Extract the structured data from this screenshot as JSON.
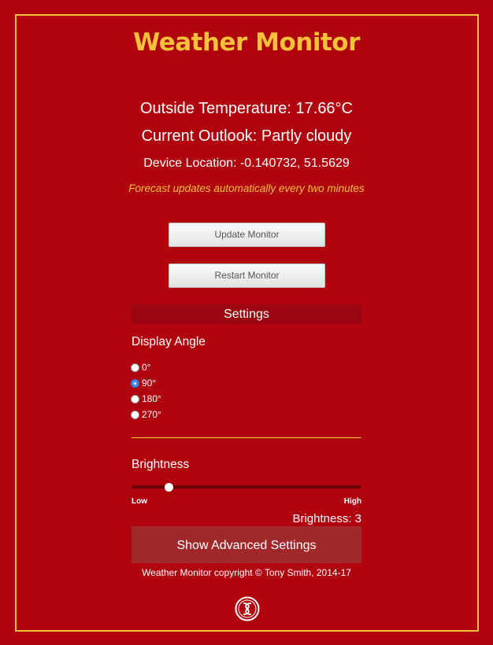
{
  "header": {
    "title": "Weather Monitor"
  },
  "status": {
    "temperature_line": "Outside Temperature: 17.66°C",
    "outlook_line": "Current Outlook: Partly cloudy",
    "location_line": "Device Location: -0.140732, 51.5629",
    "update_note": "Forecast updates automatically every two minutes"
  },
  "actions": {
    "update_label": "Update Monitor",
    "restart_label": "Restart Monitor"
  },
  "settings": {
    "heading": "Settings",
    "display_angle": {
      "label": "Display Angle",
      "options": [
        "0°",
        "90°",
        "180°",
        "270°"
      ],
      "selected": "90°"
    },
    "brightness": {
      "label": "Brightness",
      "low_label": "Low",
      "high_label": "High",
      "value_text": "Brightness: 3",
      "level_fraction": 0.16
    },
    "advanced_label": "Show Advanced Settings"
  },
  "footer": {
    "copyright": "Weather Monitor copyright © Tony Smith, 2014-17",
    "logo_icon": "seal-logo-icon"
  },
  "colors": {
    "background": "#b0040f",
    "accent": "#f3c13a",
    "panel": "#9b0510",
    "advanced_panel": "#a1282a",
    "radio_selected": "#3b8eea"
  }
}
